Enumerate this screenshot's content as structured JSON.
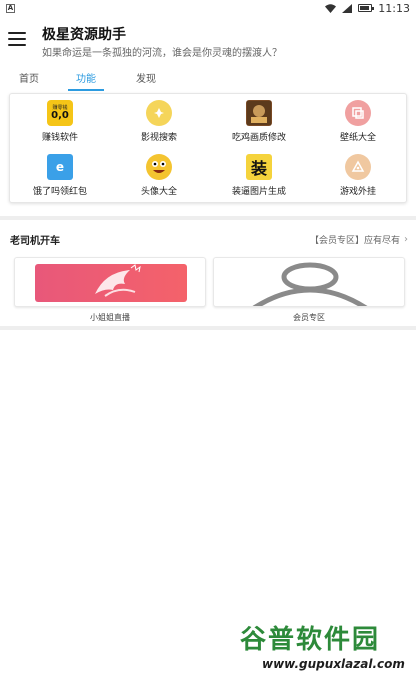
{
  "status_bar": {
    "time": "11:13",
    "battery_level": 0.85
  },
  "header": {
    "title": "极星资源助手",
    "subtitle": "如果命运是一条孤独的河流，谁会是你灵魂的摆渡人？"
  },
  "tabs": [
    {
      "label": "首页"
    },
    {
      "label": "功能"
    },
    {
      "label": "发现"
    }
  ],
  "active_tab": "功能",
  "features": [
    {
      "label": "赚钱软件",
      "icon": "earn-money-icon",
      "icon_text_top": "赚零钱",
      "icon_text_face": "0,0"
    },
    {
      "label": "影视搜索",
      "icon": "movie-search-icon"
    },
    {
      "label": "吃鸡画质修改",
      "icon": "game-graphics-icon"
    },
    {
      "label": "壁纸大全",
      "icon": "wallpaper-icon"
    },
    {
      "label": "饿了吗领红包",
      "icon": "eleme-icon",
      "icon_text": "e"
    },
    {
      "label": "头像大全",
      "icon": "avatar-emoji-icon"
    },
    {
      "label": "装逼图片生成",
      "icon": "zhuang-icon",
      "icon_text": "装"
    },
    {
      "label": "游戏外挂",
      "icon": "game-plugin-icon"
    }
  ],
  "section": {
    "title": "老司机开车",
    "more": "【会员专区】应有尽有"
  },
  "cards": [
    {
      "label": "小姐姐直播"
    },
    {
      "label": "会员专区"
    }
  ],
  "watermark": {
    "main": "谷普软件园",
    "url": "www.gupuxlazal.com"
  },
  "colors": {
    "accent": "#2c9be0",
    "watermark": "#2d8a3a"
  }
}
